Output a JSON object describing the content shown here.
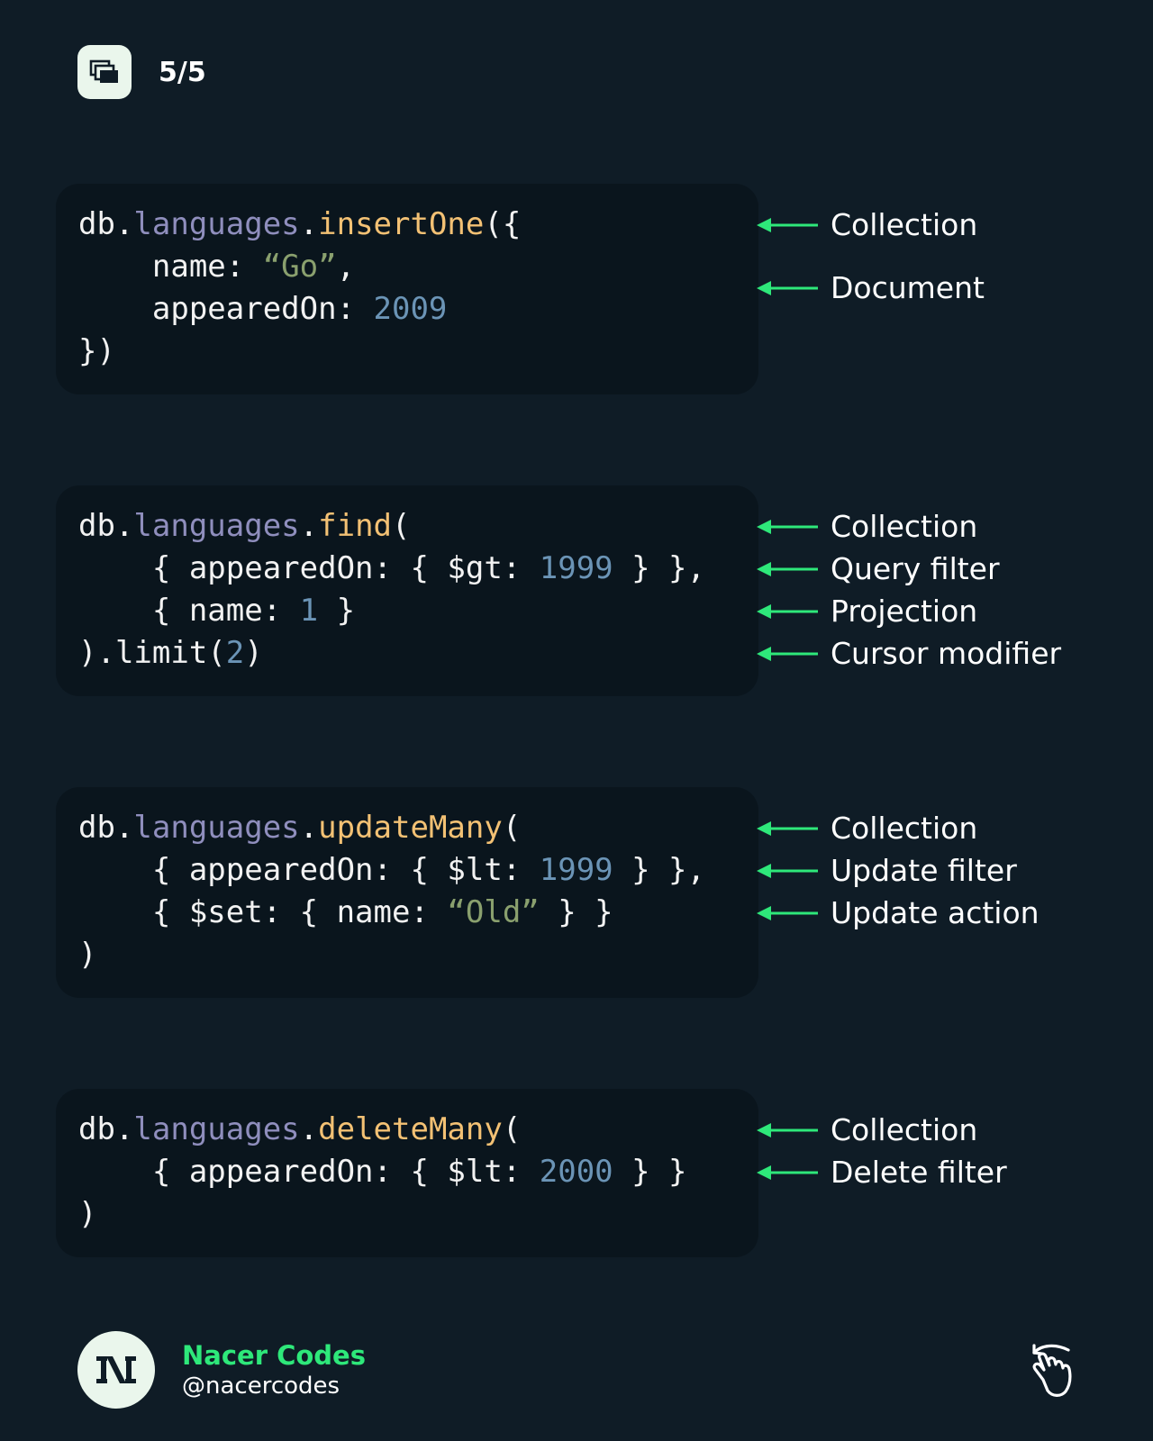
{
  "header": {
    "page_counter": "5/5",
    "icon": "carousel-icon"
  },
  "blocks": [
    {
      "lines": [
        [
          {
            "t": "db.",
            "c": ""
          },
          {
            "t": "languages",
            "c": "coll"
          },
          {
            "t": ".",
            "c": ""
          },
          {
            "t": "insertOne",
            "c": "meth"
          },
          {
            "t": "({",
            "c": ""
          }
        ],
        [
          {
            "t": "    name: ",
            "c": ""
          },
          {
            "t": "“Go”",
            "c": "str"
          },
          {
            "t": ",",
            "c": ""
          }
        ],
        [
          {
            "t": "    appearedOn: ",
            "c": ""
          },
          {
            "t": "2009",
            "c": "num"
          }
        ],
        [
          {
            "t": "})",
            "c": ""
          }
        ]
      ],
      "annotations": [
        "Collection",
        "Document"
      ]
    },
    {
      "lines": [
        [
          {
            "t": "db.",
            "c": ""
          },
          {
            "t": "languages",
            "c": "coll"
          },
          {
            "t": ".",
            "c": ""
          },
          {
            "t": "find",
            "c": "meth"
          },
          {
            "t": "(",
            "c": ""
          }
        ],
        [
          {
            "t": "    { appearedOn: { $gt: ",
            "c": ""
          },
          {
            "t": "1999",
            "c": "num"
          },
          {
            "t": " } },",
            "c": ""
          }
        ],
        [
          {
            "t": "    { name: ",
            "c": ""
          },
          {
            "t": "1",
            "c": "num"
          },
          {
            "t": " }",
            "c": ""
          }
        ],
        [
          {
            "t": ").limit(",
            "c": ""
          },
          {
            "t": "2",
            "c": "num"
          },
          {
            "t": ")",
            "c": ""
          }
        ]
      ],
      "annotations": [
        "Collection",
        "Query filter",
        "Projection",
        "Cursor modifier"
      ]
    },
    {
      "lines": [
        [
          {
            "t": "db.",
            "c": ""
          },
          {
            "t": "languages",
            "c": "coll"
          },
          {
            "t": ".",
            "c": ""
          },
          {
            "t": "updateMany",
            "c": "meth"
          },
          {
            "t": "(",
            "c": ""
          }
        ],
        [
          {
            "t": "    { appearedOn: { $lt: ",
            "c": ""
          },
          {
            "t": "1999",
            "c": "num"
          },
          {
            "t": " } },",
            "c": ""
          }
        ],
        [
          {
            "t": "    { $set: { name: ",
            "c": ""
          },
          {
            "t": "“Old”",
            "c": "str"
          },
          {
            "t": " } }",
            "c": ""
          }
        ],
        [
          {
            "t": ")",
            "c": ""
          }
        ]
      ],
      "annotations": [
        "Collection",
        "Update filter",
        "Update action"
      ]
    },
    {
      "lines": [
        [
          {
            "t": "db.",
            "c": ""
          },
          {
            "t": "languages",
            "c": "coll"
          },
          {
            "t": ".",
            "c": ""
          },
          {
            "t": "deleteMany",
            "c": "meth"
          },
          {
            "t": "(",
            "c": ""
          }
        ],
        [
          {
            "t": "    { appearedOn: { $lt: ",
            "c": ""
          },
          {
            "t": "2000",
            "c": "num"
          },
          {
            "t": " } }",
            "c": ""
          }
        ],
        [
          {
            "t": ")",
            "c": ""
          }
        ]
      ],
      "annotations": [
        "Collection",
        "Delete filter"
      ]
    }
  ],
  "footer": {
    "name": "Nacer Codes",
    "handle": "@nacercodes",
    "avatar_icon": "nacer-codes-logo",
    "swipe_icon": "swipe-hand-icon"
  },
  "colors": {
    "background": "#0f1c26",
    "code_block": "#0a151d",
    "collection": "#8f8ebd",
    "method": "#f3c174",
    "string": "#8aa06e",
    "number": "#6b94b6",
    "arrow": "#2ee87a",
    "brand": "#2ee87a"
  }
}
